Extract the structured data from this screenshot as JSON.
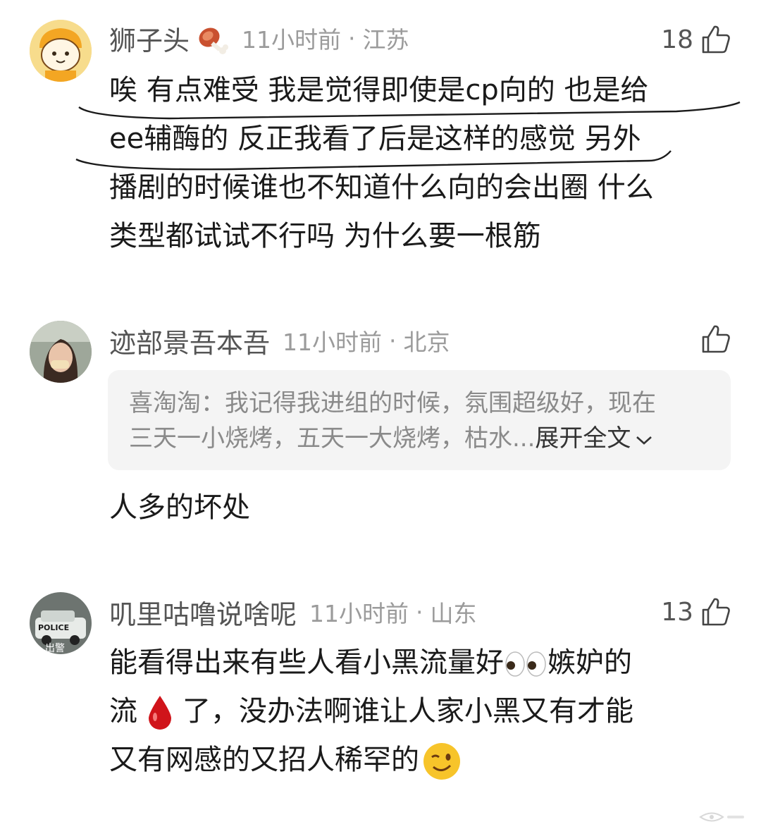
{
  "comments": [
    {
      "username": "狮子头",
      "time": "11小时前",
      "location": "江苏",
      "likes": "18",
      "lines": [
        "唉 有点难受 我是觉得即使是cp向的 也是给",
        "ee辅酶的 反正我看了后是这样的感觉 另外",
        "播剧的时候谁也不知道什么向的会出圈 什么",
        "类型都试试不行吗 为什么要一根筋"
      ]
    },
    {
      "username": "迹部景吾本吾",
      "time": "11小时前",
      "location": "北京",
      "likes": "",
      "quote": {
        "author": "喜淘淘",
        "line1": "我记得我进组的时候，氛围超级好，现在",
        "line2": "三天一小烧烤，五天一大烧烤，枯水...",
        "expand": "展开全文"
      },
      "text": "人多的坏处"
    },
    {
      "username": "叽里咕噜说啥呢",
      "time": "11小时前",
      "location": "山东",
      "likes": "13",
      "line1_before": "能看得出来有些人看小黑流量好",
      "line1_after": "嫉妒的",
      "line2_before": "流",
      "line2_after": "了，没办法啊谁让人家小黑又有才能",
      "line3": "又有网感的又招人稀罕的",
      "avatar_label_top": "POLICE",
      "avatar_label_bottom": "出警"
    }
  ],
  "separator": "·",
  "colors": {
    "username": "#555555",
    "meta": "#9b9b9b",
    "text": "#1a1a1a",
    "quote_bg": "#f4f4f4"
  },
  "icons": [
    "thumbs-up-icon",
    "meat-emoji",
    "eyes-emoji",
    "blood-drop-emoji",
    "wink-emoji"
  ]
}
